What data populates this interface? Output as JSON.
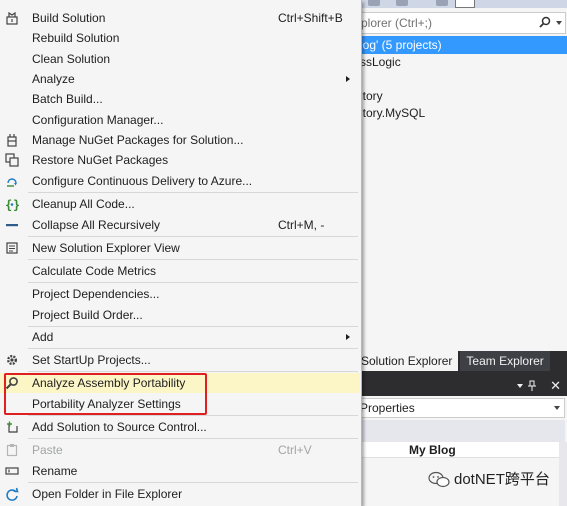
{
  "explorer": {
    "search_placeholder": "plorer (Ctrl+;)",
    "rows": [
      "log' (5 projects)",
      "ssLogic",
      "",
      "itory",
      "itory.MySQL"
    ],
    "tabs": [
      "Solution Explorer",
      "Team Explorer"
    ]
  },
  "properties": {
    "header": "Properties",
    "value": "My Blog"
  },
  "watermark": "dotNET跨平台",
  "menu": {
    "items": [
      {
        "label": "Build Solution",
        "shortcut": "Ctrl+Shift+B",
        "icon": "build-icon"
      },
      {
        "label": "Rebuild Solution"
      },
      {
        "label": "Clean Solution"
      },
      {
        "label": "Analyze",
        "submenu": true
      },
      {
        "label": "Batch Build..."
      },
      {
        "label": "Configuration Manager..."
      },
      {
        "label": "Manage NuGet Packages for Solution...",
        "icon": "nuget-icon"
      },
      {
        "label": "Restore NuGet Packages",
        "icon": "restore-icon"
      },
      {
        "label": "Configure Continuous Delivery to Azure...",
        "icon": "azure-delivery-icon"
      },
      {
        "label": "Cleanup All Code...",
        "icon": "cleanup-icon"
      },
      {
        "label": "Collapse All Recursively",
        "shortcut": "Ctrl+M, -",
        "icon": "collapse-icon"
      },
      {
        "label": "New Solution Explorer View",
        "icon": "new-view-icon"
      },
      {
        "label": "Calculate Code Metrics"
      },
      {
        "label": "Project Dependencies..."
      },
      {
        "label": "Project Build Order..."
      },
      {
        "label": "Add",
        "submenu": true
      },
      {
        "label": "Set StartUp Projects...",
        "icon": "gear-icon"
      },
      {
        "label": "Analyze Assembly Portability",
        "icon": "magnifier-icon"
      },
      {
        "label": "Portability Analyzer Settings"
      },
      {
        "label": "Add Solution to Source Control...",
        "icon": "source-control-icon"
      },
      {
        "label": "Paste",
        "shortcut": "Ctrl+V",
        "icon": "paste-icon",
        "disabled": true
      },
      {
        "label": "Rename",
        "icon": "rename-icon"
      },
      {
        "label": "Open Folder in File Explorer",
        "icon": "open-folder-icon"
      }
    ]
  },
  "colors": {
    "highlight": "#fcf6c6",
    "selection": "#3399ff",
    "callout": "#e02020"
  }
}
